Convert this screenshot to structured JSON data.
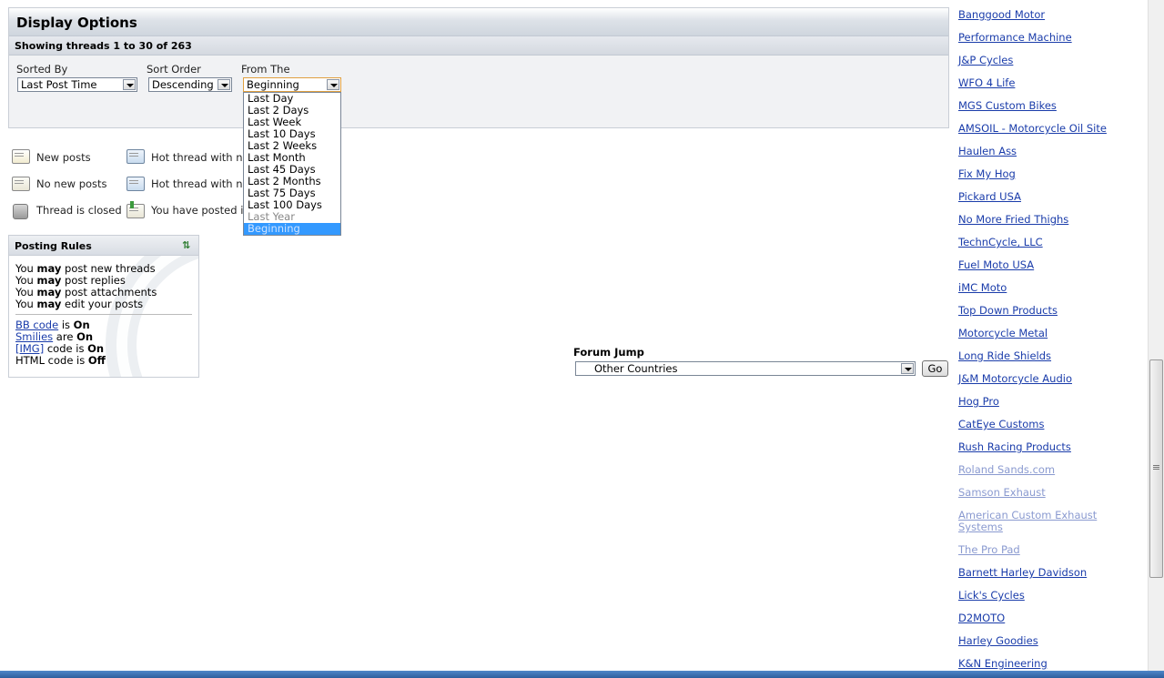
{
  "display_options": {
    "title": "Display Options",
    "showing": "Showing threads 1 to 30 of 263",
    "sorted_by": {
      "label": "Sorted By",
      "value": "Last Post Time"
    },
    "sort_order": {
      "label": "Sort Order",
      "value": "Descending"
    },
    "from_the": {
      "label": "From The",
      "value": "Beginning",
      "options": [
        "Last Day",
        "Last 2 Days",
        "Last Week",
        "Last 10 Days",
        "Last 2 Weeks",
        "Last Month",
        "Last 45 Days",
        "Last 2 Months",
        "Last 75 Days",
        "Last 100 Days",
        "Last Year",
        "Beginning"
      ]
    }
  },
  "legend": {
    "new_posts": "New posts",
    "no_new_posts": "No new posts",
    "thread_closed": "Thread is closed",
    "hot_new": "Hot thread with ne",
    "hot_no_new": "Hot thread with no",
    "posted": "You have posted i"
  },
  "posting_rules": {
    "title": "Posting Rules",
    "lines": [
      {
        "pre": "You ",
        "bold": "may",
        "post": " post new threads"
      },
      {
        "pre": "You ",
        "bold": "may",
        "post": " post replies"
      },
      {
        "pre": "You ",
        "bold": "may",
        "post": " post attachments"
      },
      {
        "pre": "You ",
        "bold": "may",
        "post": " edit your posts"
      }
    ],
    "bb_code": {
      "link": "BB code",
      "mid": " is ",
      "state": "On"
    },
    "smilies": {
      "link": "Smilies",
      "mid": " are ",
      "state": "On"
    },
    "img_code": {
      "link": "[IMG]",
      "mid": " code is ",
      "state": "On"
    },
    "html_code": {
      "text": "HTML code is ",
      "state": "Off"
    }
  },
  "forum_jump": {
    "label": "Forum Jump",
    "value": "Other Countries",
    "go": "Go"
  },
  "sponsor_links": [
    "Banggood Motor",
    "Performance Machine",
    "J&P Cycles",
    "WFO 4 Life",
    "MGS Custom Bikes",
    "AMSOIL - Motorcycle Oil Site",
    "Haulen Ass",
    "Fix My Hog",
    "Pickard USA",
    "No More Fried Thighs",
    "TechnCycle, LLC",
    "Fuel Moto USA",
    "iMC Moto",
    "Top Down Products",
    "Motorcycle Metal",
    "Long Ride Shields",
    "J&M Motorcycle Audio",
    "Hog Pro",
    "CatEye Customs",
    "Rush Racing Products",
    "Roland Sands.com",
    "Samson Exhaust",
    "American Custom Exhaust Systems",
    "The Pro Pad",
    "Barnett Harley Davidson",
    "Lick's Cycles",
    "D2MOTO",
    "Harley Goodies",
    "K&N Engineering"
  ]
}
